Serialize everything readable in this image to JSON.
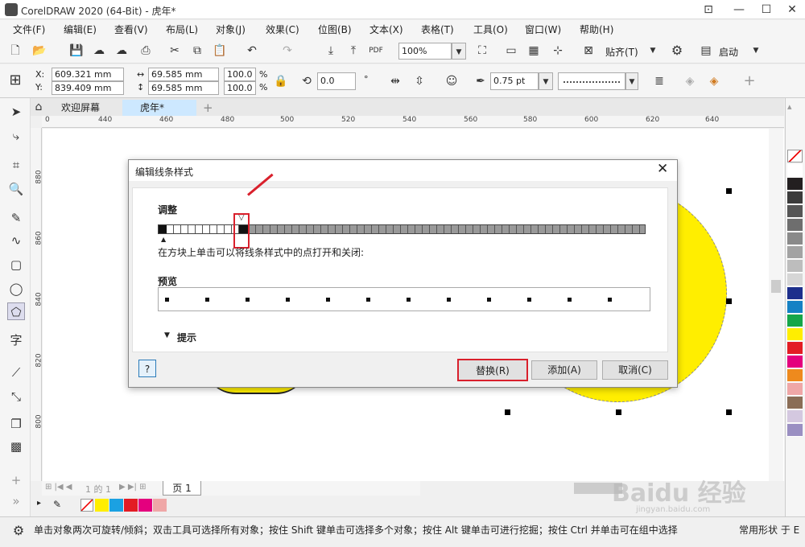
{
  "app": {
    "title": "CorelDRAW 2020 (64-Bit) - 虎年*"
  },
  "menu": [
    "文件(F)",
    "编辑(E)",
    "查看(V)",
    "布局(L)",
    "对象(J)",
    "效果(C)",
    "位图(B)",
    "文本(X)",
    "表格(T)",
    "工具(O)",
    "窗口(W)",
    "帮助(H)"
  ],
  "toolbar": {
    "zoom": "100%",
    "snap_label": "贴齐(T)",
    "launch_label": "启动"
  },
  "props": {
    "x_label": "X:",
    "y_label": "Y:",
    "x": "609.321 mm",
    "y": "839.409 mm",
    "w": "69.585 mm",
    "h": "69.585 mm",
    "sx": "100.0",
    "sy": "100.0",
    "pct": "%",
    "angle": "0.0",
    "deg": "°",
    "outline": "0.75 pt"
  },
  "tabs": {
    "welcome": "欢迎屏幕",
    "doc": "虎年*",
    "add": "+"
  },
  "ruler_h": [
    "0",
    "440",
    "460",
    "480",
    "500",
    "520",
    "540",
    "560",
    "580",
    "600",
    "620",
    "640"
  ],
  "ruler_v": [
    "880",
    "860",
    "840",
    "820",
    "800"
  ],
  "page_nav": {
    "pages": "1 的 1",
    "page_tab": "页 1"
  },
  "status": {
    "hint": "单击对象两次可旋转/倾斜；双击工具可选择所有对象；按住 Shift 键单击可选择多个对象；按住 Alt 键单击可进行挖掘；按住 Ctrl 并单击可在组中选择",
    "right": "常用形状 于 E"
  },
  "dialog": {
    "title": "编辑线条样式",
    "adjust_label": "调整",
    "hint": "在方块上单击可以将线条样式中的点打开和关闭:",
    "preview_label": "预览",
    "tips_label": "提示",
    "help_btn": "?",
    "replace_btn": "替换(R)",
    "add_btn": "添加(A)",
    "cancel_btn": "取消(C)"
  },
  "colors": {
    "accent": "#d9202c",
    "circle": "#ffee00",
    "selected_tab": "#cde8ff"
  },
  "palette": [
    "#ffffff",
    "#231f20",
    "#3b3b3b",
    "#555555",
    "#6e6e6e",
    "#8a8a8a",
    "#a3a3a3",
    "#bdbdbd",
    "#d6d6d6",
    "#1d2f8c",
    "#1581c4",
    "#15a649",
    "#ffee00",
    "#e31c24",
    "#e4007e",
    "#ee8a1d",
    "#efa7a7",
    "#8a6d56",
    "#d4c8e0",
    "#9a8fc2"
  ],
  "doc_palette": [
    "#ffee00",
    "#1ba1e2",
    "#e31c24",
    "#e4007e",
    "#efa7a7"
  ],
  "watermark": "Baidu 经验",
  "watermark_sub": "jingyan.baidu.com"
}
